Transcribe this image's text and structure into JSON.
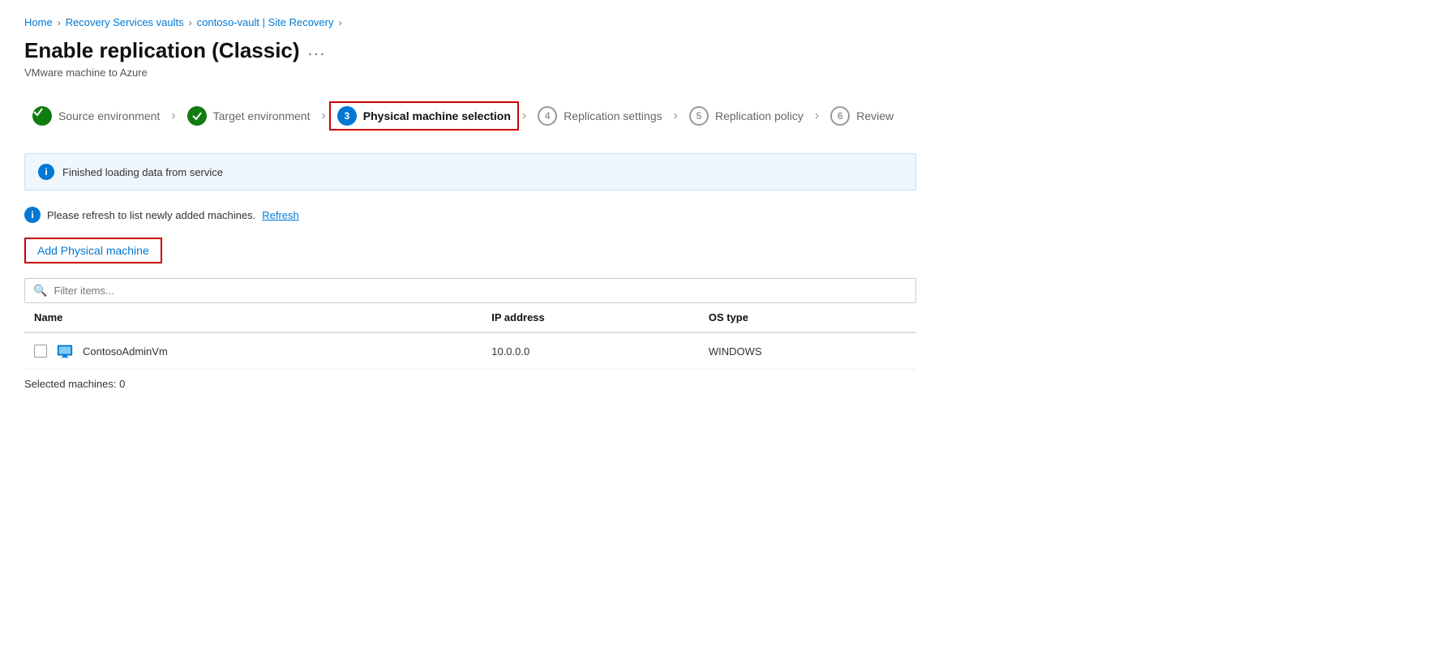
{
  "breadcrumb": {
    "items": [
      {
        "label": "Home",
        "href": "#"
      },
      {
        "label": "Recovery Services vaults",
        "href": "#"
      },
      {
        "label": "contoso-vault | Site Recovery",
        "href": "#"
      }
    ]
  },
  "page": {
    "title": "Enable replication (Classic)",
    "subtitle": "VMware machine to Azure",
    "more_dots": "..."
  },
  "stepper": {
    "steps": [
      {
        "number": "1",
        "label": "Source environment",
        "state": "complete"
      },
      {
        "number": "2",
        "label": "Target environment",
        "state": "complete"
      },
      {
        "number": "3",
        "label": "Physical machine selection",
        "state": "current"
      },
      {
        "number": "4",
        "label": "Replication settings",
        "state": "pending"
      },
      {
        "number": "5",
        "label": "Replication policy",
        "state": "pending"
      },
      {
        "number": "6",
        "label": "Review",
        "state": "pending"
      }
    ]
  },
  "info_banner": {
    "message": "Finished loading data from service"
  },
  "refresh_notice": {
    "text": "Please refresh to list newly added machines.",
    "link_label": "Refresh"
  },
  "add_button": {
    "label": "Add Physical machine"
  },
  "filter": {
    "placeholder": "Filter items..."
  },
  "table": {
    "columns": [
      "Name",
      "IP address",
      "OS type"
    ],
    "rows": [
      {
        "name": "ContosoAdminVm",
        "ip": "10.0.0.0",
        "os": "WINDOWS",
        "checked": false
      }
    ]
  },
  "selected_count": {
    "label": "Selected machines: 0"
  }
}
